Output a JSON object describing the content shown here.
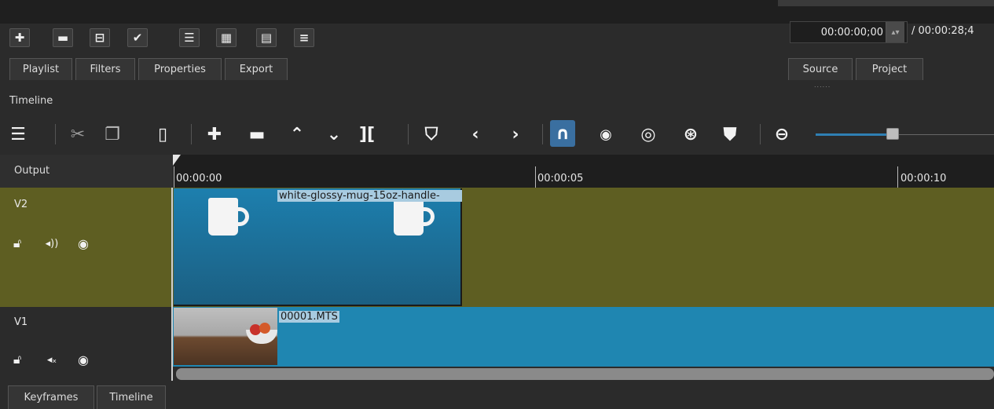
{
  "toolbar_top": {
    "buttons": [
      {
        "name": "add-button",
        "glyph": "✚"
      },
      {
        "name": "remove-button",
        "glyph": "▬"
      },
      {
        "name": "update-button",
        "glyph": "⊟"
      },
      {
        "name": "apply-button",
        "glyph": "✔"
      },
      {
        "name": "list-view-button",
        "glyph": "☰"
      },
      {
        "name": "icon-view-button",
        "glyph": "▦"
      },
      {
        "name": "detail-view-button",
        "glyph": "▤"
      },
      {
        "name": "menu-button",
        "glyph": "≡"
      }
    ]
  },
  "tabs": {
    "playlist": "Playlist",
    "filters": "Filters",
    "properties": "Properties",
    "export": "Export",
    "source": "Source",
    "project": "Project"
  },
  "timecode": {
    "current": "00:00:00;00",
    "total": "/ 00:00:28;4"
  },
  "timeline": {
    "title": "Timeline",
    "output_label": "Output",
    "ruler": [
      "00:00:00",
      "00:00:05",
      "00:00:10"
    ]
  },
  "timeline_toolbar": {
    "icons": [
      "menu-icon",
      "cut-icon",
      "copy-icon",
      "paste-icon",
      "append-icon",
      "remove-icon",
      "lift-icon",
      "overwrite-icon",
      "split-icon",
      "marker-icon",
      "previous-icon",
      "next-icon",
      "snap-icon",
      "scrub-icon",
      "ripple-icon",
      "ripple-all-icon",
      "ripple-markers-icon",
      "zoom-out-icon"
    ],
    "zoom_level": 0.4
  },
  "tracks": [
    {
      "name": "V2",
      "clip_label": "white-glossy-mug-15oz-handle-"
    },
    {
      "name": "V1",
      "clip_label": "00001.MTS"
    }
  ],
  "bottom_tabs": {
    "keyframes": "Keyframes",
    "timeline": "Timeline"
  },
  "colors": {
    "track_selected": "#5e5e22",
    "clip_blue": "#1f86b1",
    "snap_active": "#3a6fa0"
  }
}
